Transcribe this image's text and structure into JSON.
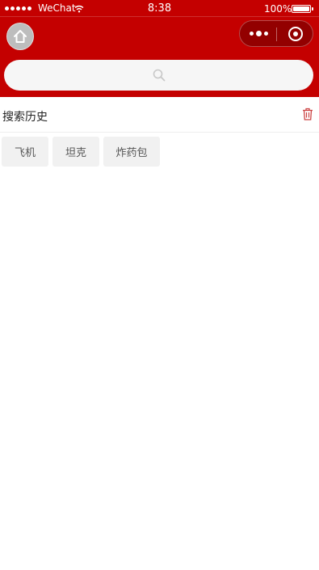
{
  "status_bar": {
    "carrier": "WeChat",
    "time": "8:38",
    "battery": "100%"
  },
  "search": {
    "placeholder": "",
    "value": ""
  },
  "history": {
    "title": "搜索历史",
    "items": [
      "飞机",
      "坦克",
      "炸药包"
    ]
  },
  "colors": {
    "header_bg": "#c40000",
    "tag_bg": "#f1f1f1"
  },
  "icons": [
    "home-icon",
    "more-icon",
    "close-mini-program-icon",
    "search-icon",
    "trash-icon",
    "wifi-icon",
    "battery-icon",
    "signal-icon"
  ]
}
